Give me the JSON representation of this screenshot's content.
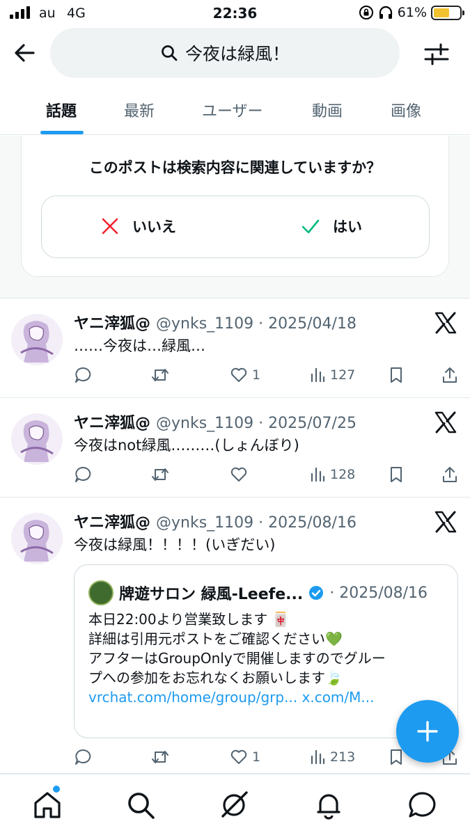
{
  "status": {
    "carrier": "au",
    "network": "4G",
    "time": "22:36",
    "battery_text": "61%",
    "battery_level": 0.61
  },
  "search": {
    "query": "今夜は緑風！"
  },
  "tabs": [
    {
      "label": "話題",
      "active": true
    },
    {
      "label": "最新",
      "active": false
    },
    {
      "label": "ユーザー",
      "active": false
    },
    {
      "label": "動画",
      "active": false
    },
    {
      "label": "画像",
      "active": false
    }
  ],
  "feedback": {
    "question": "このポストは検索内容に関連していますか？",
    "no_label": "いいえ",
    "yes_label": "はい"
  },
  "posts": [
    {
      "name": "ヤニ滓狐@",
      "meta": "@ynks_1109 · 2025/04/18",
      "text": "……今夜は…緑風…",
      "replies": "",
      "reposts": "",
      "likes": "1",
      "views": "127"
    },
    {
      "name": "ヤニ滓狐@",
      "meta": "@ynks_1109 · 2025/07/25",
      "text": "今夜はnot緑風………(しょんぼり)",
      "replies": "",
      "reposts": "",
      "likes": "",
      "views": "128"
    },
    {
      "name": "ヤニ滓狐@",
      "meta": "@ynks_1109 · 2025/08/16",
      "text": "今夜は緑風！！！！(いぎだい)",
      "replies": "",
      "reposts": "",
      "likes": "1",
      "views": "213",
      "quote": {
        "name": "牌遊サロン 緑風-Leefe...",
        "date": "· 2025/08/16",
        "lines": [
          "本日22:00より営業致します 🀄",
          "詳細は引用元ポストをご確認ください💚",
          "アフターはGroupOnlyで開催しますのでグルー",
          "プへの参加をお忘れなくお願いします🍃"
        ],
        "links": "vrchat.com/home/group/grp... x.com/M..."
      }
    }
  ],
  "icons": {
    "back": "back-arrow-icon",
    "search": "search-icon",
    "filter": "filter-sliders-icon",
    "close": "x-mark-icon",
    "check": "check-icon",
    "x_logo": "x-logo-icon",
    "reply": "reply-icon",
    "repost": "repost-icon",
    "like": "heart-icon",
    "views": "views-icon",
    "bookmark": "bookmark-icon",
    "share": "share-icon",
    "compose": "compose-plus-icon",
    "nav": [
      "home-icon",
      "search-icon",
      "grok-icon",
      "notifications-icon",
      "messages-icon"
    ]
  },
  "colors": {
    "accent": "#1d9bf0",
    "no": "#f4212e",
    "yes": "#00ba7c",
    "text": "#0f1419",
    "secondary": "#536471"
  }
}
